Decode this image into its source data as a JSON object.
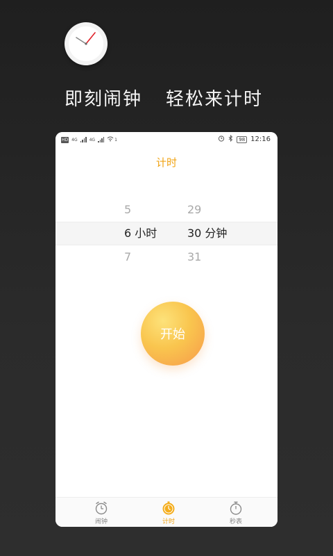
{
  "headline": {
    "part1": "即刻闹钟",
    "part2": "轻松来计时"
  },
  "status_bar": {
    "hd": "HD",
    "net1": "4G",
    "net2": "4G",
    "wifi_sup": "1",
    "battery": "98",
    "time": "12:16"
  },
  "screen": {
    "title": "计时"
  },
  "picker": {
    "hour_prev": "5",
    "hour_selected": "6",
    "hour_unit": "小时",
    "hour_next": "7",
    "minute_prev": "29",
    "minute_selected": "30",
    "minute_unit": "分钟",
    "minute_next": "31"
  },
  "start_button": {
    "label": "开始"
  },
  "bottom_nav": {
    "items": [
      {
        "label": "闹钟",
        "icon": "alarm-clock-icon"
      },
      {
        "label": "计时",
        "icon": "timer-icon"
      },
      {
        "label": "秒表",
        "icon": "stopwatch-icon"
      }
    ],
    "active_index": 1
  },
  "colors": {
    "accent": "#f0a313",
    "background": "#2a2a2a",
    "card": "#ffffff",
    "button_gradient_start": "#fde27a",
    "button_gradient_end": "#f59a4e"
  }
}
